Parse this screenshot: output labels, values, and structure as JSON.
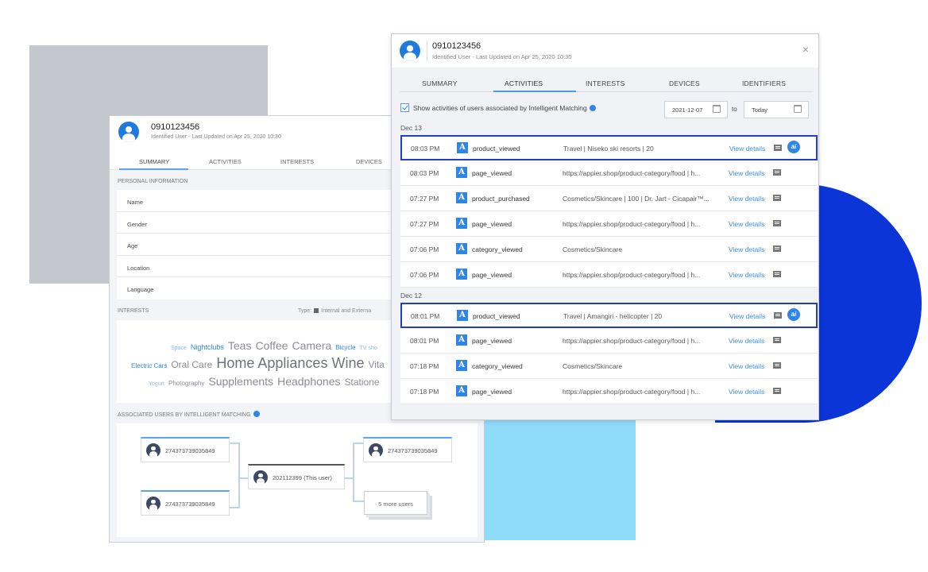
{
  "back_panel": {
    "user_id": "0910123456",
    "subtitle": "Identified User  -  Last Updated on Apr 25, 2020 10:30",
    "tabs": [
      "SUMMARY",
      "ACTIVITIES",
      "INTERESTS",
      "DEVICES"
    ],
    "active_tab": "SUMMARY",
    "personal_info_label": "PERSONAL INFORMATION",
    "personal_fields": [
      "Name",
      "Gender",
      "Age",
      "Location",
      "Language"
    ],
    "interests_label": "INTERESTS",
    "type_label": "Type:",
    "type_value": "Internal and Externa",
    "cloud_lines": [
      [
        {
          "t": "Space",
          "c": "w-lblue",
          "s": 7
        },
        {
          "t": "Nightclubs",
          "c": "w-blue",
          "s": 9
        },
        {
          "t": "Teas",
          "c": "w-gray",
          "s": 14
        },
        {
          "t": "Coffee",
          "c": "w-gray",
          "s": 14
        },
        {
          "t": "Camera",
          "c": "w-gray",
          "s": 14
        },
        {
          "t": "Bicycle",
          "c": "w-blue",
          "s": 8
        },
        {
          "t": "TV sho",
          "c": "w-lblue",
          "s": 7
        }
      ],
      [
        {
          "t": "Electric Cars",
          "c": "w-blue",
          "s": 8
        },
        {
          "t": "Oral Care",
          "c": "w-gray",
          "s": 12
        },
        {
          "t": "Home Appliances",
          "c": "w-dark",
          "s": 18
        },
        {
          "t": "Wine",
          "c": "w-dark",
          "s": 18
        },
        {
          "t": "Vita",
          "c": "w-gray",
          "s": 12
        }
      ],
      [
        {
          "t": "Yogurt",
          "c": "w-lblue",
          "s": 7
        },
        {
          "t": "Photography",
          "c": "w-gray",
          "s": 8
        },
        {
          "t": "Supplements",
          "c": "w-gray",
          "s": 14
        },
        {
          "t": "Headphones",
          "c": "w-gray",
          "s": 14
        },
        {
          "t": "Statione",
          "c": "w-gray",
          "s": 12
        }
      ]
    ],
    "associated_label": "ASSOCIATED USERS BY INTELLIGENT MATCHING",
    "graph": {
      "top_left": "274373739035849",
      "bottom_left": "274373739035849",
      "center": "202112399 (This user)",
      "top_right": "274373739035849",
      "more": "5 more users"
    }
  },
  "front_panel": {
    "user_id": "0910123456",
    "subtitle": "Identified User  -  Last Updated on Apr 25, 2020 10:30",
    "tabs": [
      "SUMMARY",
      "ACTIVITIES",
      "INTERESTS",
      "DEVICES",
      "IDENTIFIERS"
    ],
    "active_tab": "ACTIVITIES",
    "checkbox_label": "Show activities of users associated by Intelligent Matching",
    "date_from": "2021-12-07",
    "to_label": "to",
    "date_to": "Today",
    "days": [
      {
        "label": "Dec 13",
        "rows": [
          {
            "time": "08:03 PM",
            "event": "product_viewed",
            "detail": "Travel | Niseko ski resorts | 20",
            "view": "View details",
            "ai": true
          },
          {
            "time": "08:03 PM",
            "event": "page_viewed",
            "detail": "https://appier.shop/product-category/food | h...",
            "view": "View details",
            "ai": false
          },
          {
            "time": "07:27 PM",
            "event": "product_purchased",
            "detail": "Cosmetics/Skincare | 100 | Dr. Jart - Cicapair™...",
            "view": "View details",
            "ai": false
          },
          {
            "time": "07:27 PM",
            "event": "page_viewed",
            "detail": "https://appier.shop/product-category/food | h...",
            "view": "View details",
            "ai": false
          },
          {
            "time": "07:06 PM",
            "event": "category_viewed",
            "detail": "Cosmetics/Skincare",
            "view": "View details",
            "ai": false
          },
          {
            "time": "07:06 PM",
            "event": "page_viewed",
            "detail": "https://appier.shop/product-category/food | h...",
            "view": "View details",
            "ai": false
          }
        ]
      },
      {
        "label": "Dec 12",
        "rows": [
          {
            "time": "08:01 PM",
            "event": "product_viewed",
            "detail": "Travel | Amangiri - helicopter | 20",
            "view": "View details",
            "ai": true
          },
          {
            "time": "08:01 PM",
            "event": "page_viewed",
            "detail": "https://appier.shop/product-category/food | h...",
            "view": "View details",
            "ai": false
          },
          {
            "time": "07:18 PM",
            "event": "category_viewed",
            "detail": "Cosmetics/Skincare",
            "view": "View details",
            "ai": false
          },
          {
            "time": "07:18 PM",
            "event": "page_viewed",
            "detail": "https://appier.shop/product-category/food | h...",
            "view": "View details",
            "ai": false
          }
        ]
      }
    ],
    "event_icon_letter": "A",
    "ai_badge_text": "ai",
    "close_icon": "×"
  },
  "colors": {
    "accent": "#2f86e8",
    "highlight_border": "#1f3fc4",
    "bg_gray": "#c4c7ce",
    "bg_cyan": "#8fdbfa",
    "bg_blue": "#0b35d6"
  }
}
